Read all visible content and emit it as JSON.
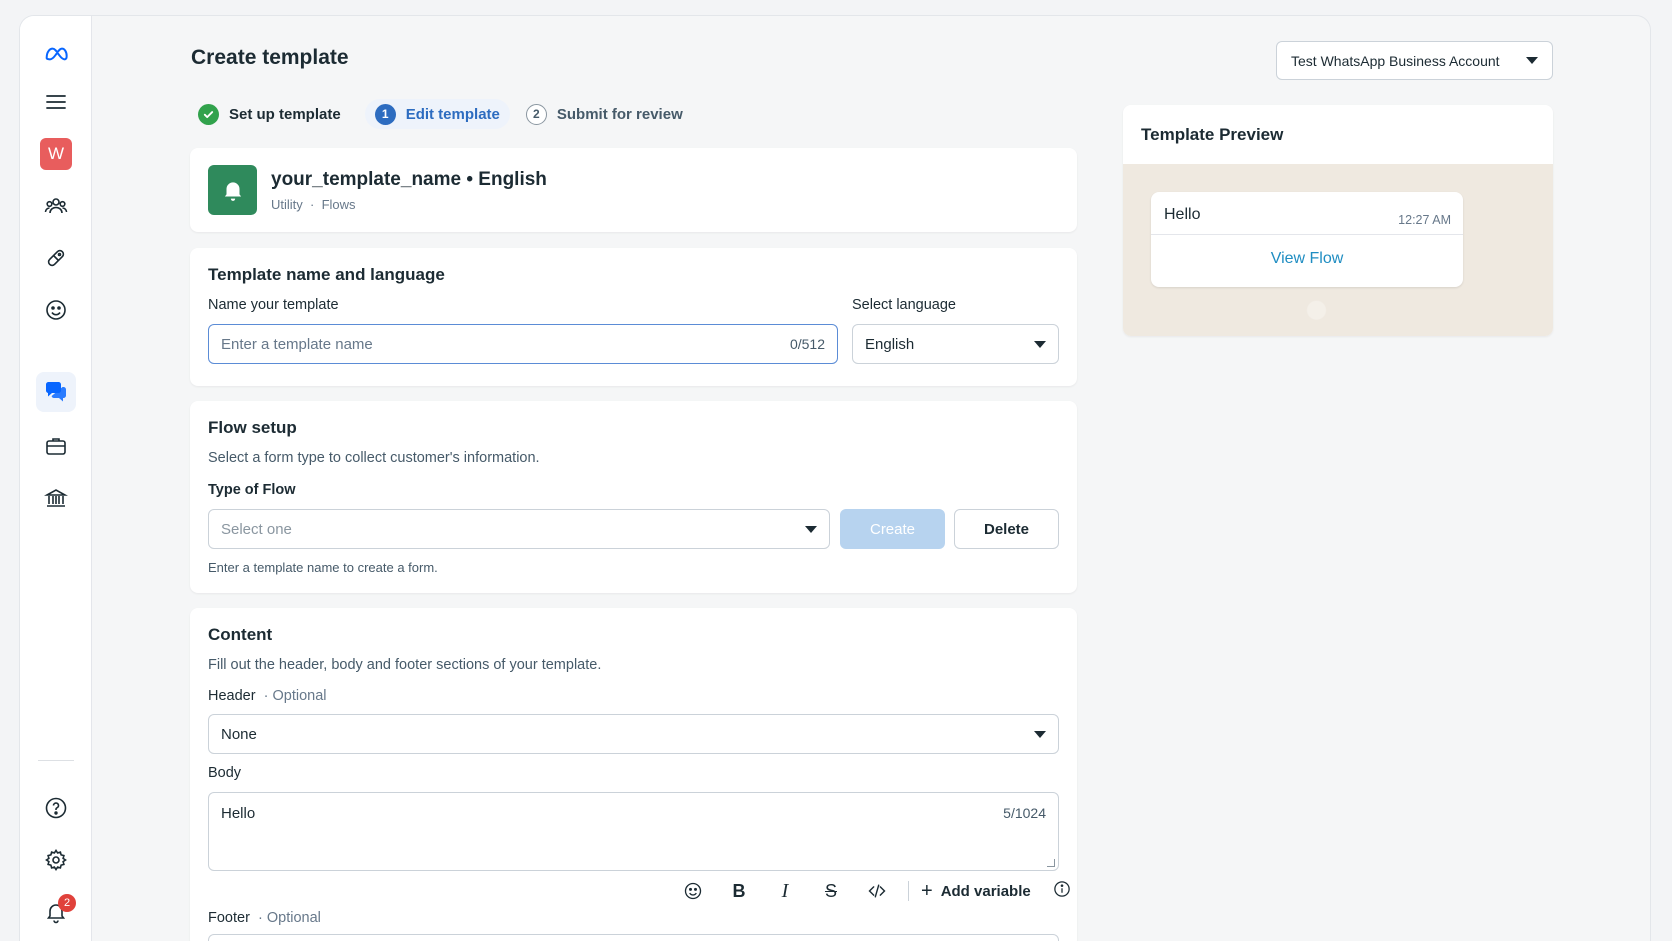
{
  "page": {
    "title": "Create template"
  },
  "account": {
    "selected": "Test WhatsApp Business Account"
  },
  "sidebar": {
    "avatar_letter": "W",
    "notification_count": "2",
    "items": [
      {
        "icon": "meta-logo-icon"
      },
      {
        "icon": "menu-icon"
      },
      {
        "icon": "workspace-avatar"
      },
      {
        "icon": "people-icon"
      },
      {
        "icon": "tag-icon"
      },
      {
        "icon": "smiley-icon"
      },
      {
        "icon": "chat-bubbles-icon",
        "active": true
      },
      {
        "icon": "briefcase-icon"
      },
      {
        "icon": "bank-icon"
      },
      {
        "icon": "help-icon"
      },
      {
        "icon": "gear-icon"
      },
      {
        "icon": "bell-icon"
      }
    ]
  },
  "steps": [
    {
      "label": "Set up template",
      "state": "done"
    },
    {
      "label": "Edit template",
      "number": "1",
      "state": "current"
    },
    {
      "label": "Submit for review",
      "number": "2",
      "state": "todo"
    }
  ],
  "template": {
    "name": "your_template_name • English",
    "category": "Utility",
    "separator": "·",
    "type": "Flows"
  },
  "name_language": {
    "title": "Template name and language",
    "name_label": "Name your template",
    "name_placeholder": "Enter a template name",
    "name_counter": "0/512",
    "language_label": "Select language",
    "language_value": "English"
  },
  "flow_setup": {
    "title": "Flow setup",
    "description": "Select a form type to collect customer's information.",
    "type_label": "Type of Flow",
    "type_placeholder": "Select one",
    "create_label": "Create",
    "delete_label": "Delete",
    "hint": "Enter a template name to create a form."
  },
  "content": {
    "title": "Content",
    "description": "Fill out the header, body and footer sections of your template.",
    "header_label": "Header",
    "header_optional": "Optional",
    "header_value": "None",
    "body_label": "Body",
    "body_value": "Hello",
    "body_counter": "5/1024",
    "add_variable_label": "Add variable",
    "footer_label": "Footer",
    "footer_optional": "Optional",
    "dot": "·"
  },
  "preview": {
    "title": "Template Preview",
    "message": "Hello",
    "time": "12:27 AM",
    "action": "View Flow"
  }
}
